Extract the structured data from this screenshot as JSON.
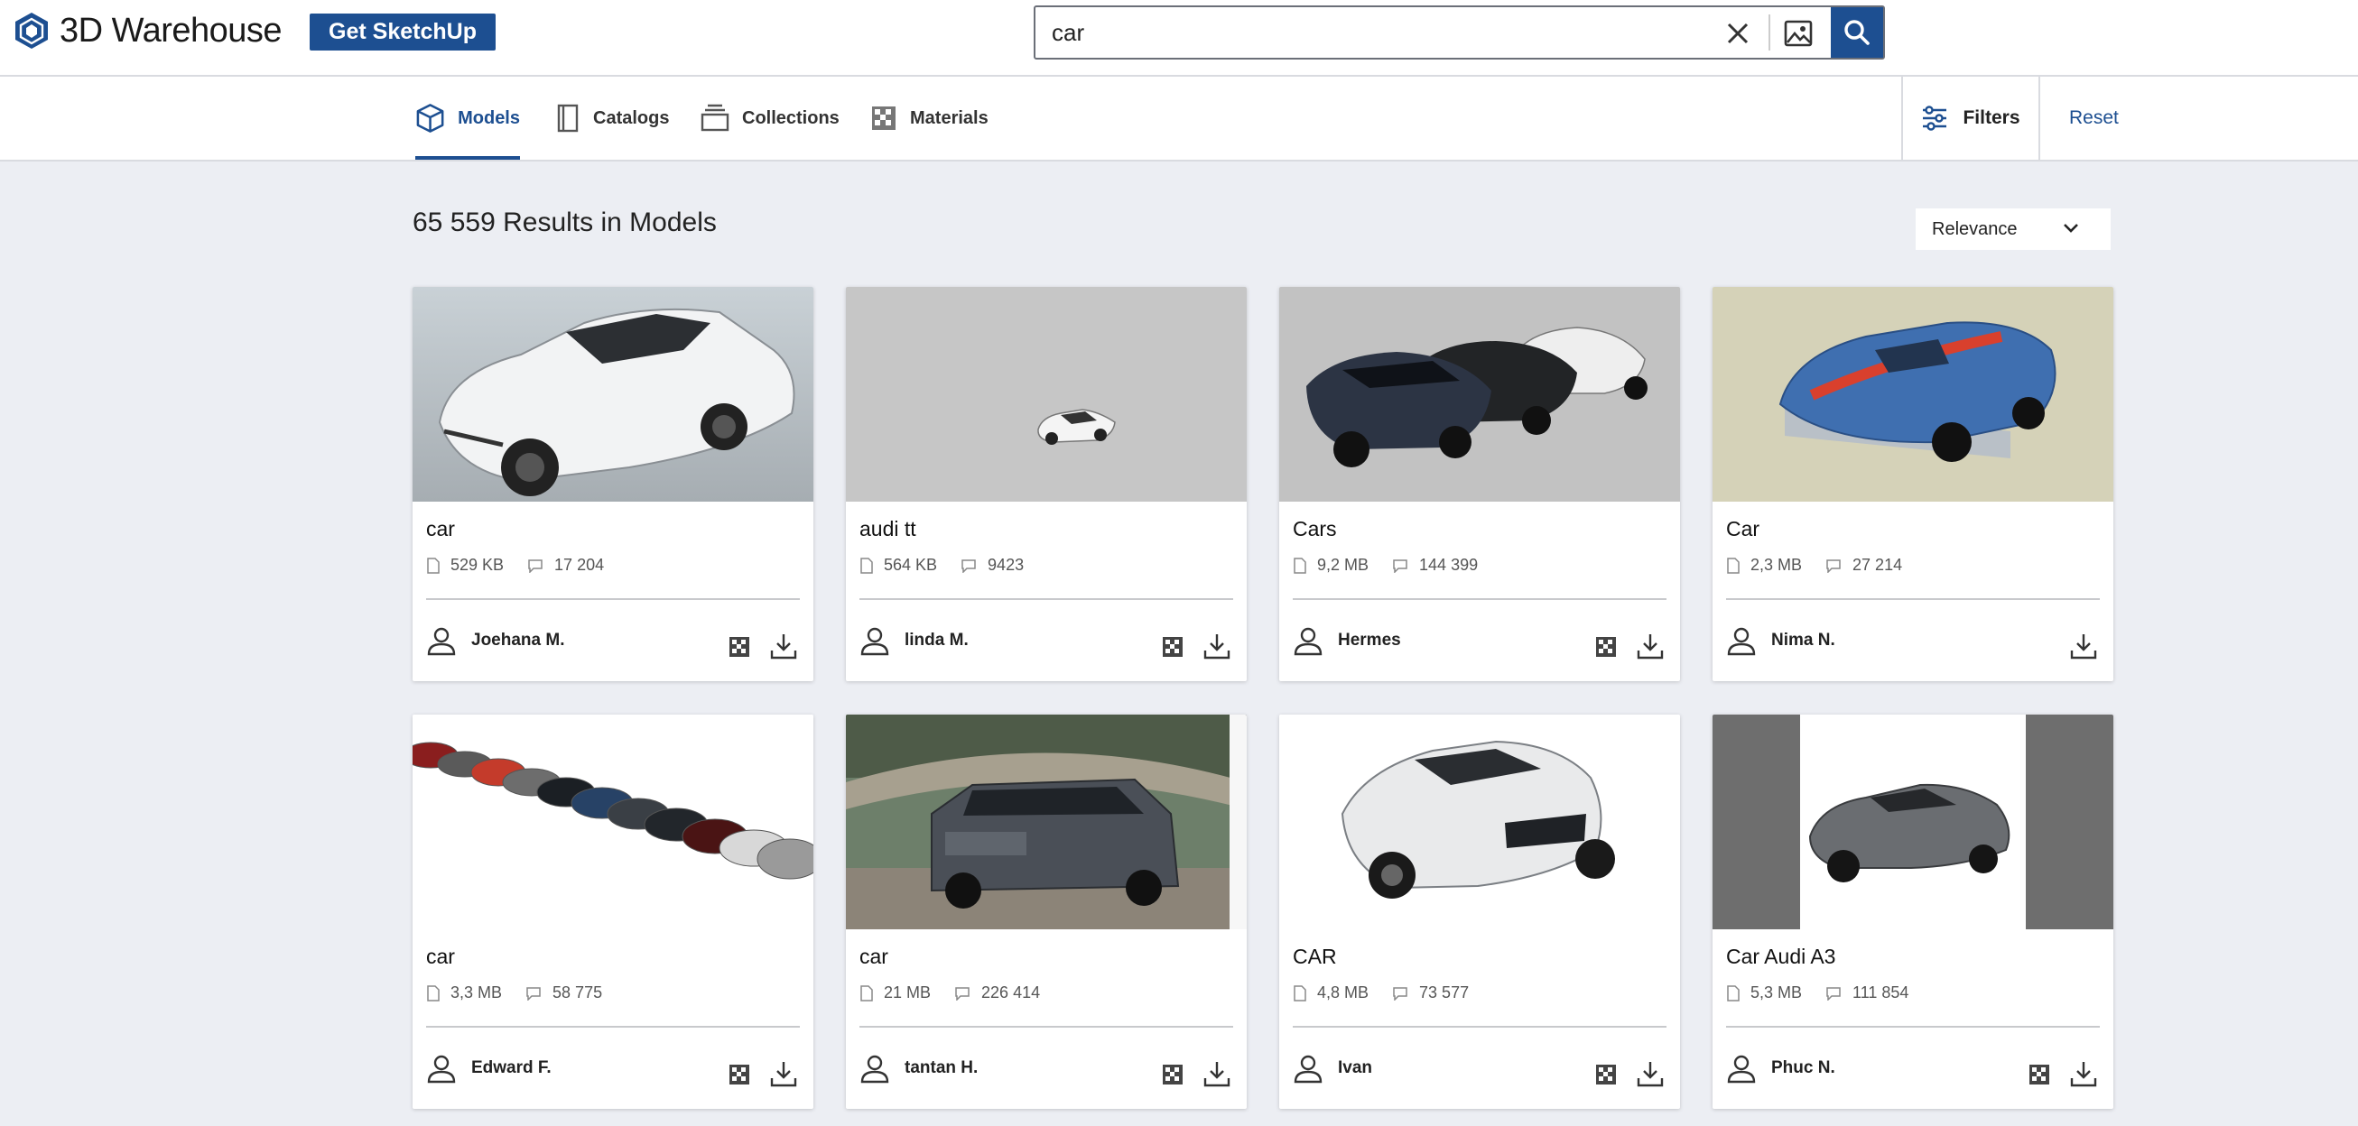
{
  "header": {
    "logo_text": "3D Warehouse",
    "cta_label": "Get SketchUp",
    "search": {
      "value": "car",
      "placeholder": ""
    },
    "accent": "#1d4f91"
  },
  "tabs": [
    {
      "label": "Models",
      "icon": "cube-icon",
      "active": true
    },
    {
      "label": "Catalogs",
      "icon": "catalog-icon",
      "active": false
    },
    {
      "label": "Collections",
      "icon": "collections-icon",
      "active": false
    },
    {
      "label": "Materials",
      "icon": "materials-icon",
      "active": false
    }
  ],
  "filters_label": "Filters",
  "reset_label": "Reset",
  "results_title": "65 559 Results in Models",
  "sort": {
    "selected": "Relevance"
  },
  "cards": [
    {
      "title": "car",
      "size": "529 KB",
      "count": "17 204",
      "author": "Joehana M.",
      "materials": true
    },
    {
      "title": "audi tt",
      "size": "564 KB",
      "count": "9423",
      "author": "linda M.",
      "materials": true
    },
    {
      "title": "Cars",
      "size": "9,2 MB",
      "count": "144 399",
      "author": "Hermes",
      "materials": true
    },
    {
      "title": "Car",
      "size": "2,3 MB",
      "count": "27 214",
      "author": "Nima N.",
      "materials": false
    },
    {
      "title": "car",
      "size": "3,3 MB",
      "count": "58 775",
      "author": "Edward F.",
      "materials": true
    },
    {
      "title": "car",
      "size": "21 MB",
      "count": "226 414",
      "author": "tantan H.",
      "materials": true
    },
    {
      "title": "CAR",
      "size": "4,8 MB",
      "count": "73 577",
      "author": "Ivan",
      "materials": true
    },
    {
      "title": "Car Audi A3",
      "size": "5,3 MB",
      "count": "111 854",
      "author": "Phuc N.",
      "materials": true
    }
  ]
}
